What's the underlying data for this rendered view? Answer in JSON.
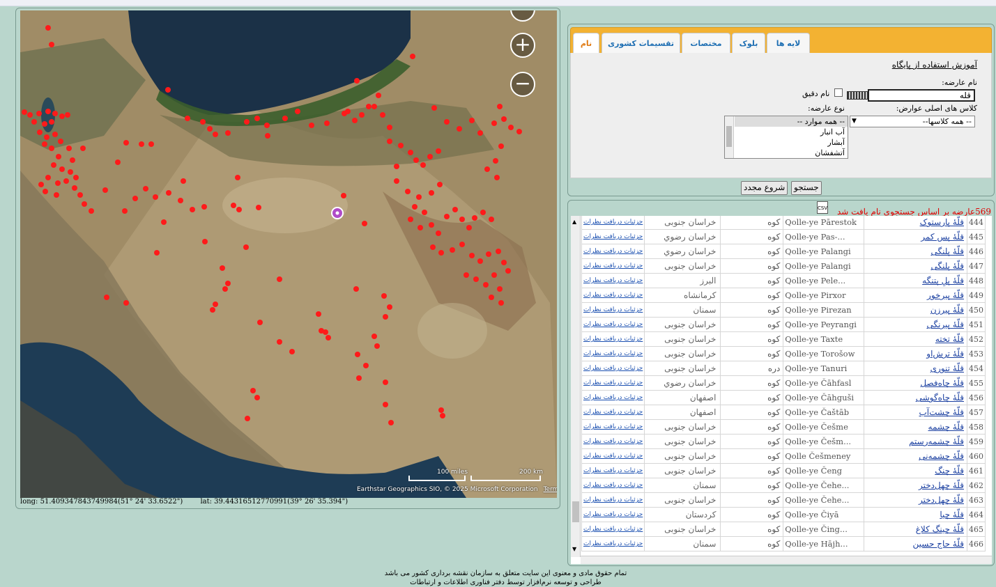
{
  "map": {
    "zoom_in": "+",
    "zoom_out": "−",
    "scale_miles": "100 miles",
    "scale_km": "200 km",
    "attribution": "Earthstar Geographics SIO, © 2025 Microsoft Corporation",
    "terms": "Terms",
    "long_text": "long: 51.409347843749984(51° 24' 33.6522\")",
    "lat_text": "lat: 39.44316512770991(39° 26' 35.394\")"
  },
  "tabs": [
    {
      "label": "لايه ها",
      "active": false
    },
    {
      "label": "بلوک",
      "active": false
    },
    {
      "label": "مختصات",
      "active": false
    },
    {
      "label": "تقسيمات کشوری",
      "active": false
    },
    {
      "label": "نام",
      "active": true
    }
  ],
  "form": {
    "help_link": "آموزش استفاده از پایگاه",
    "name_label": "نام عارضه:",
    "name_value": "قله",
    "exact_label": "نام دقيق",
    "class_label": "کلاس های اصلی عوارض:",
    "class_value": "-- همه کلاسها--",
    "type_label": "نوع عارضه:",
    "type_options": [
      "-- همه موارد --",
      "آب انبار",
      "آبشار",
      "آتشفشان"
    ],
    "search_btn": "جستجو",
    "reset_btn": "شروع مجدد"
  },
  "results": {
    "count_text": "569عارضه بر اساس جستجوی نام یافت شد",
    "csv_label": "CSV",
    "detail_text": "جزئیات دریافت نظرات",
    "rows": [
      {
        "num": "444",
        "name": "قلّۀ پارستوک",
        "latin": "Qolle-ye Pārestok",
        "type": "کوه",
        "prov": "خراسان جنوبی"
      },
      {
        "num": "445",
        "name": "قلّۀ پس کمر",
        "latin": "Qolle-ye Pas-...",
        "type": "کوه",
        "prov": "خراسان رضوي"
      },
      {
        "num": "446",
        "name": "قلّۀ پلنگی",
        "latin": "Qolle-ye Palangi",
        "type": "کوه",
        "prov": "خراسان رضوي"
      },
      {
        "num": "447",
        "name": "قلّۀ پلنگی",
        "latin": "Qolle-ye Palangi",
        "type": "کوه",
        "prov": "خراسان جنوبی"
      },
      {
        "num": "448",
        "name": "قلّۀ پلِ پتنگه",
        "latin": "Qolle-ye Pele...",
        "type": "کوه",
        "prov": "البرز"
      },
      {
        "num": "449",
        "name": "قلّۀ پیرخور",
        "latin": "Qolle-ye Pirxor",
        "type": "کوه",
        "prov": "کرمانشاه"
      },
      {
        "num": "450",
        "name": "قلّۀ پیرزن",
        "latin": "Qolle-ye Pirezan",
        "type": "کوه",
        "prov": "سمنان"
      },
      {
        "num": "451",
        "name": "قلّۀ پیرنگی",
        "latin": "Qolle-ye Peyrangi",
        "type": "کوه",
        "prov": "خراسان جنوبی"
      },
      {
        "num": "452",
        "name": "قلّۀ تخته",
        "latin": "Qolle-ye Taxte",
        "type": "کوه",
        "prov": "خراسان جنوبی"
      },
      {
        "num": "453",
        "name": "قلّۀ ترش‌او",
        "latin": "Qolle-ye Torošow",
        "type": "کوه",
        "prov": "خراسان جنوبی"
      },
      {
        "num": "454",
        "name": "قلّۀ تنوری",
        "latin": "Qolle-ye Tanuri",
        "type": "دره",
        "prov": "خراسان جنوبی"
      },
      {
        "num": "455",
        "name": "قلّۀ چاه‌فصل",
        "latin": "Qolle-ye Čāhfasl",
        "type": "کوه",
        "prov": "خراسان رضوي"
      },
      {
        "num": "456",
        "name": "قلّۀ چاه‌گوشی",
        "latin": "Qolle-ye Čāhguši",
        "type": "کوه",
        "prov": "اصفهان"
      },
      {
        "num": "457",
        "name": "قلّۀ چشت‌آب",
        "latin": "Qolle-ye Čaštāb",
        "type": "کوه",
        "prov": "اصفهان"
      },
      {
        "num": "458",
        "name": "قلّۀ چشمه",
        "latin": "Qolle-ye Češme",
        "type": "کوه",
        "prov": "خراسان جنوبی"
      },
      {
        "num": "459",
        "name": "قلّۀ چشمه‌رستم",
        "latin": "Qolle-ye Češm...",
        "type": "کوه",
        "prov": "خراسان جنوبی"
      },
      {
        "num": "460",
        "name": "قلّۀ چشمه‌نی",
        "latin": "Qolle Češmeney",
        "type": "کوه",
        "prov": "خراسان جنوبی"
      },
      {
        "num": "461",
        "name": "قلّۀ چنگ",
        "latin": "Qolle-ye Čeng",
        "type": "کوه",
        "prov": "خراسان جنوبی"
      },
      {
        "num": "462",
        "name": "قلّۀ چهل‌دختر",
        "latin": "Qolle-ye Čehe...",
        "type": "کوه",
        "prov": "سمنان"
      },
      {
        "num": "463",
        "name": "قلّۀ چهل‌دختر",
        "latin": "Qolle-ye Čehe...",
        "type": "کوه",
        "prov": "خراسان جنوبی"
      },
      {
        "num": "464",
        "name": "قلّۀ چیا",
        "latin": "Qolle-ye Čiyā",
        "type": "کوه",
        "prov": "کردستان"
      },
      {
        "num": "465",
        "name": "قلّۀ چینگ کلاغ",
        "latin": "Qolle-ye Čing...",
        "type": "کوه",
        "prov": "خراسان جنوبی"
      },
      {
        "num": "466",
        "name": "قلّۀ حاج حسین",
        "latin": "Qolle-ye Hājh...",
        "type": "کوه",
        "prov": "سمنان"
      }
    ]
  },
  "footer": {
    "line1": "تمام حقوق مادی و معنوی این سایت متعلق به سازمان نقشه برداری کشور می باشد",
    "line2": "طراحی و توسعه نرم‌افزار توسط دفتر فناوری اطلاعات و ارتباطات"
  }
}
